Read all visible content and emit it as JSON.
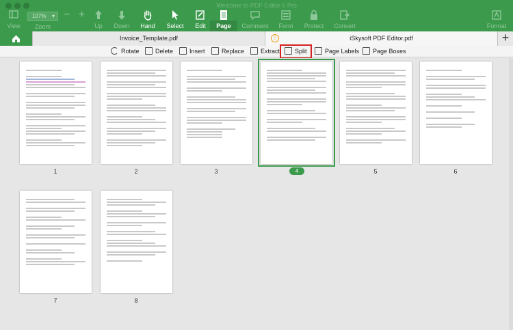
{
  "window": {
    "title": "Welcome to PDF Editor 6 Pro"
  },
  "toolbar": {
    "view": "View",
    "zoom_value": "107%",
    "zoom_label": "Zoom",
    "minus": "−",
    "plus": "+",
    "up": "Up",
    "down": "Down",
    "hand": "Hand",
    "select": "Select",
    "edit": "Edit",
    "page": "Page",
    "comment": "Comment",
    "form": "Form",
    "protect": "Protect",
    "convert": "Convert",
    "format": "Format"
  },
  "tabs": {
    "tab1": "Invoice_Template.pdf",
    "tab2": "iSkysoft PDF Editor.pdf",
    "warn": "!",
    "add": "+"
  },
  "pagebar": {
    "rotate": "Rotate",
    "delete": "Delete",
    "insert": "Insert",
    "replace": "Replace",
    "extract": "Extract",
    "split": "Split",
    "page_labels": "Page Labels",
    "page_boxes": "Page Boxes"
  },
  "pages": {
    "p1": "1",
    "p2": "2",
    "p3": "3",
    "p4": "4",
    "p5": "5",
    "p6": "6",
    "p7": "7",
    "p8": "8"
  },
  "colors": {
    "accent": "#3c9a4c",
    "highlight": "#d42020"
  }
}
